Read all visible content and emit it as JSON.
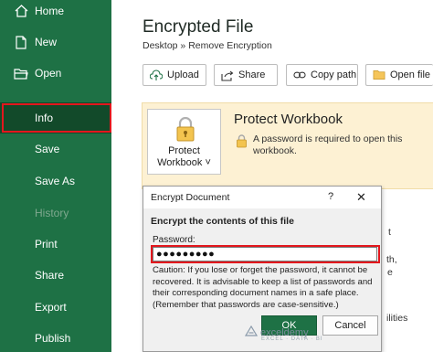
{
  "sidebar": {
    "items": [
      {
        "label": "Home",
        "icon": "home-icon"
      },
      {
        "label": "New",
        "icon": "new-document-icon"
      },
      {
        "label": "Open",
        "icon": "folder-open-icon"
      },
      {
        "label": "Info",
        "active": true
      },
      {
        "label": "Save"
      },
      {
        "label": "Save As"
      },
      {
        "label": "History",
        "disabled": true
      },
      {
        "label": "Print"
      },
      {
        "label": "Share"
      },
      {
        "label": "Export"
      },
      {
        "label": "Publish"
      }
    ]
  },
  "main": {
    "title": "Encrypted File",
    "breadcrumb": "Desktop » Remove Encryption",
    "toolbar": [
      {
        "label": "Upload",
        "icon": "upload-icon"
      },
      {
        "label": "Share",
        "icon": "share-icon"
      },
      {
        "label": "Copy path",
        "icon": "link-icon"
      },
      {
        "label": "Open file l",
        "icon": "folder-icon"
      }
    ],
    "protect": {
      "button_line1": "Protect",
      "button_line2": "Workbook ˅",
      "heading": "Protect Workbook",
      "description": "A password is required to open this workbook."
    },
    "right_fragments": [
      "t",
      "th,",
      "e",
      "ilities"
    ]
  },
  "dialog": {
    "title": "Encrypt Document",
    "help": "?",
    "close": "✕",
    "heading": "Encrypt the contents of this file",
    "password_label": "Password:",
    "password_value": "●●●●●●●●●",
    "caution": "Caution: If you lose or forget the password, it cannot be recovered. It is advisable to keep a list of passwords and their corresponding document names in a safe place. (Remember that passwords are case-sensitive.)",
    "ok_label": "OK",
    "cancel_label": "Cancel"
  },
  "watermark": {
    "brand": "exceldemy",
    "tagline": "EXCEL · DATA · BI"
  },
  "colors": {
    "sidebar_bg": "#1e7145",
    "active_bg": "#124a2a",
    "highlight_red": "#e3171d",
    "protect_bg": "#fdf1d3"
  }
}
